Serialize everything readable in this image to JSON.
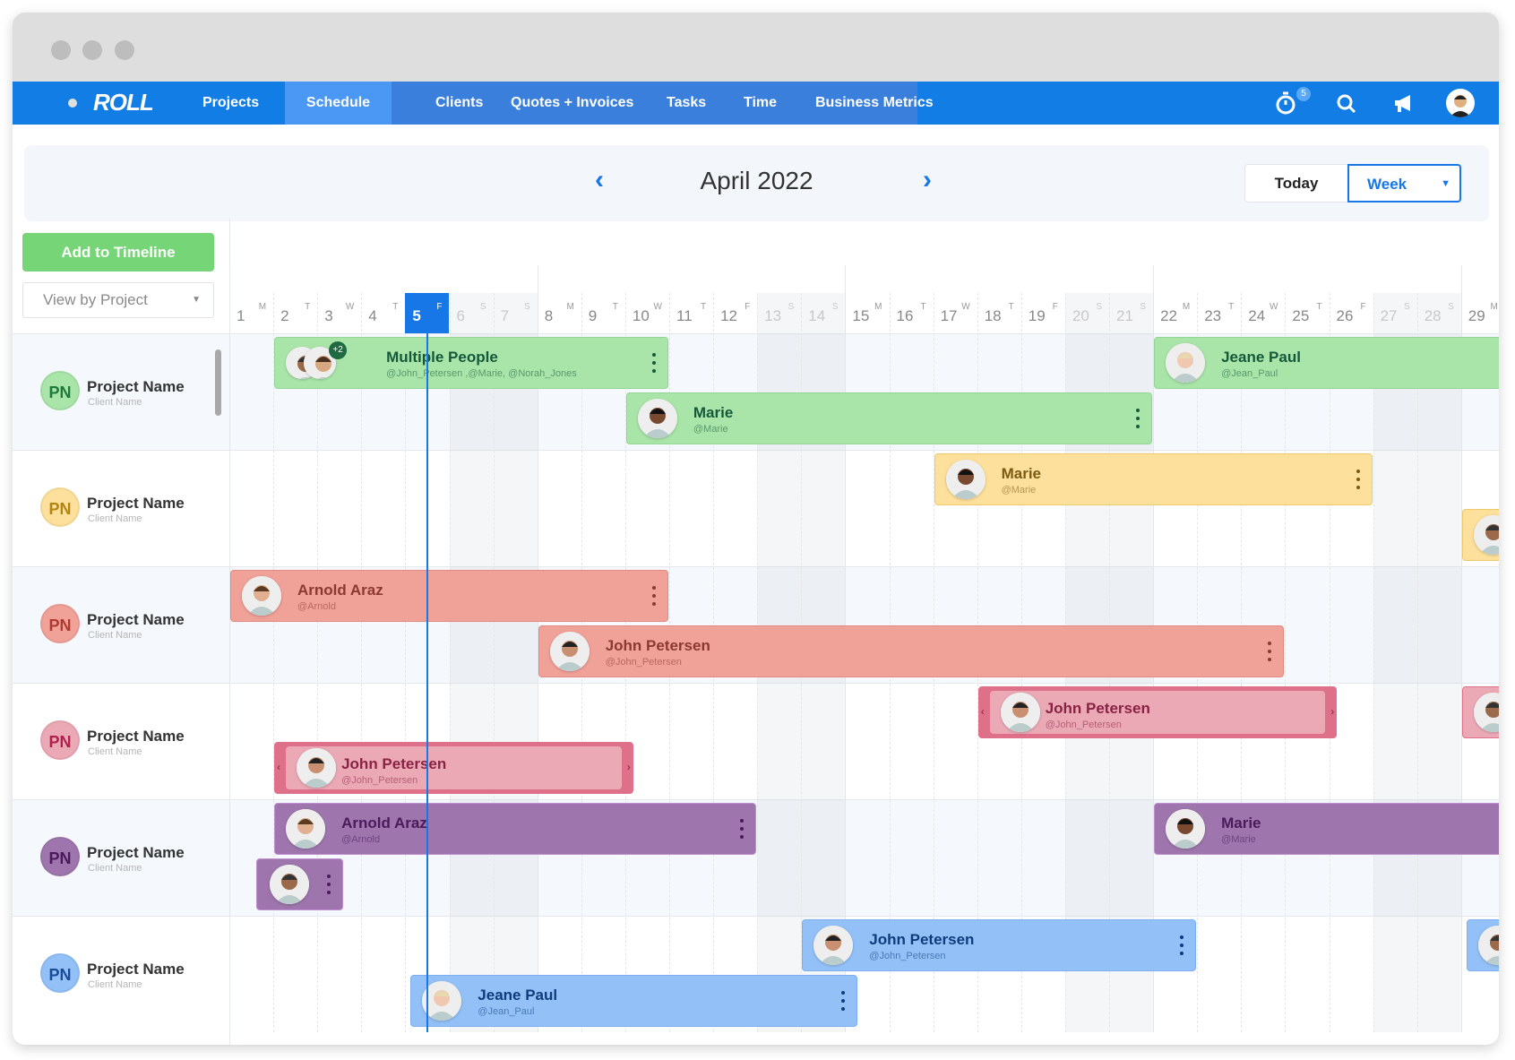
{
  "app": {
    "logo": "ROLL"
  },
  "nav": {
    "items": [
      {
        "label": "Projects"
      },
      {
        "label": "Schedule",
        "active": true
      },
      {
        "label": "Clients"
      },
      {
        "label": "Quotes + Invoices"
      },
      {
        "label": "Tasks"
      },
      {
        "label": "Time"
      },
      {
        "label": "Business Metrics"
      }
    ],
    "timer_badge": "5",
    "icons": [
      "stopwatch-icon",
      "search-icon",
      "megaphone-icon",
      "user-avatar"
    ]
  },
  "calendar": {
    "month": "April 2022",
    "today_label": "Today",
    "view_label": "Week",
    "today_day": 5
  },
  "sidebar": {
    "add_button": "Add to Timeline",
    "view_select": "View by Project"
  },
  "days": [
    {
      "n": "1",
      "l": "M"
    },
    {
      "n": "2",
      "l": "T"
    },
    {
      "n": "3",
      "l": "W"
    },
    {
      "n": "4",
      "l": "T"
    },
    {
      "n": "5",
      "l": "F"
    },
    {
      "n": "6",
      "l": "S"
    },
    {
      "n": "7",
      "l": "S"
    },
    {
      "n": "8",
      "l": "M"
    },
    {
      "n": "9",
      "l": "T"
    },
    {
      "n": "10",
      "l": "W"
    },
    {
      "n": "11",
      "l": "T"
    },
    {
      "n": "12",
      "l": "F"
    },
    {
      "n": "13",
      "l": "S"
    },
    {
      "n": "14",
      "l": "S"
    },
    {
      "n": "15",
      "l": "M"
    },
    {
      "n": "16",
      "l": "T"
    },
    {
      "n": "17",
      "l": "W"
    },
    {
      "n": "18",
      "l": "T"
    },
    {
      "n": "19",
      "l": "F"
    },
    {
      "n": "20",
      "l": "S"
    },
    {
      "n": "21",
      "l": "S"
    },
    {
      "n": "22",
      "l": "M"
    },
    {
      "n": "23",
      "l": "T"
    },
    {
      "n": "24",
      "l": "W"
    },
    {
      "n": "25",
      "l": "T"
    },
    {
      "n": "26",
      "l": "F"
    },
    {
      "n": "27",
      "l": "S"
    },
    {
      "n": "28",
      "l": "S"
    },
    {
      "n": "29",
      "l": "M"
    }
  ],
  "colors": {
    "green": {
      "bg": "#a9e5a9",
      "border": "#93d693",
      "text": "#16593a",
      "pn": "#1d7a3c"
    },
    "yellow": {
      "bg": "#fde09b",
      "border": "#eec96c",
      "text": "#7c5a12",
      "pn": "#b48411"
    },
    "salmon": {
      "bg": "#f0a198",
      "border": "#df8a80",
      "text": "#8c3a30",
      "pn": "#b03a30"
    },
    "pink": {
      "bg": "#eba9b6",
      "border": "#de7089",
      "text": "#8a2244",
      "pn": "#b0204e"
    },
    "purple": {
      "bg": "#9e76ad",
      "border": "#c08fd0",
      "text": "#4a1a5a",
      "pn": "#4a1a5a"
    },
    "blue": {
      "bg": "#93c1f7",
      "border": "#7caff0",
      "text": "#0e3c7c",
      "pn": "#1a4a9a"
    },
    "accent": "#1877e6"
  },
  "projects": [
    {
      "initials": "PN",
      "name": "Project Name",
      "client": "Client Name",
      "color": "green",
      "bars": [
        {
          "name": "Multiple People",
          "handle": "@John_Petersen ,@Marie, @Norah_Jones",
          "start": 2,
          "end": 10,
          "lane": 0,
          "multi": "+2"
        },
        {
          "name": "Marie",
          "handle": "@Marie",
          "start": 10,
          "end": 21,
          "lane": 1
        },
        {
          "name": "Jeane Paul",
          "handle": "@Jean_Paul",
          "start": 22,
          "end": 31,
          "lane": 0
        }
      ]
    },
    {
      "initials": "PN",
      "name": "Project Name",
      "client": "Client Name",
      "color": "yellow",
      "bars": [
        {
          "name": "Marie",
          "handle": "@Marie",
          "start": 17,
          "end": 26,
          "lane": 0
        },
        {
          "name": "",
          "handle": "",
          "start": 29,
          "end": 31,
          "lane": 1
        }
      ]
    },
    {
      "initials": "PN",
      "name": "Project Name",
      "client": "Client Name",
      "color": "salmon",
      "bars": [
        {
          "name": "Arnold Araz",
          "handle": "@Arnold",
          "start": 1,
          "end": 10,
          "lane": 0
        },
        {
          "name": "John Petersen",
          "handle": "@John_Petersen",
          "start": 8,
          "end": 24,
          "lane": 1
        }
      ]
    },
    {
      "initials": "PN",
      "name": "Project Name",
      "client": "Client Name",
      "color": "pink",
      "bars": [
        {
          "name": "John Petersen",
          "handle": "@John_Petersen",
          "start": 18,
          "end": 25.2,
          "lane": 0,
          "resize": true
        },
        {
          "name": "John Petersen",
          "handle": "@John_Petersen",
          "start": 2,
          "end": 9.2,
          "lane": 1,
          "resize": true
        },
        {
          "name": "",
          "handle": "",
          "start": 29,
          "end": 31,
          "lane": 0
        }
      ]
    },
    {
      "initials": "PN",
      "name": "Project Name",
      "client": "Client Name",
      "color": "purple",
      "bars": [
        {
          "name": "Arnold Araz",
          "handle": "@Arnold",
          "start": 2,
          "end": 12,
          "lane": 0
        },
        {
          "name": "Marie",
          "handle": "@Marie",
          "start": 22,
          "end": 31,
          "lane": 0
        },
        {
          "name": "",
          "handle": "",
          "start": 1.6,
          "end": 2.6,
          "lane": 1,
          "compact": true
        }
      ]
    },
    {
      "initials": "PN",
      "name": "Project Name",
      "client": "Client Name",
      "color": "blue",
      "bars": [
        {
          "name": "John Petersen",
          "handle": "@John_Petersen",
          "start": 14,
          "end": 22,
          "lane": 0
        },
        {
          "name": "Jeane Paul",
          "handle": "@Jean_Paul",
          "start": 5.1,
          "end": 14.3,
          "lane": 1
        },
        {
          "name": "",
          "handle": "",
          "start": 29.1,
          "end": 31,
          "lane": 0
        }
      ]
    }
  ]
}
